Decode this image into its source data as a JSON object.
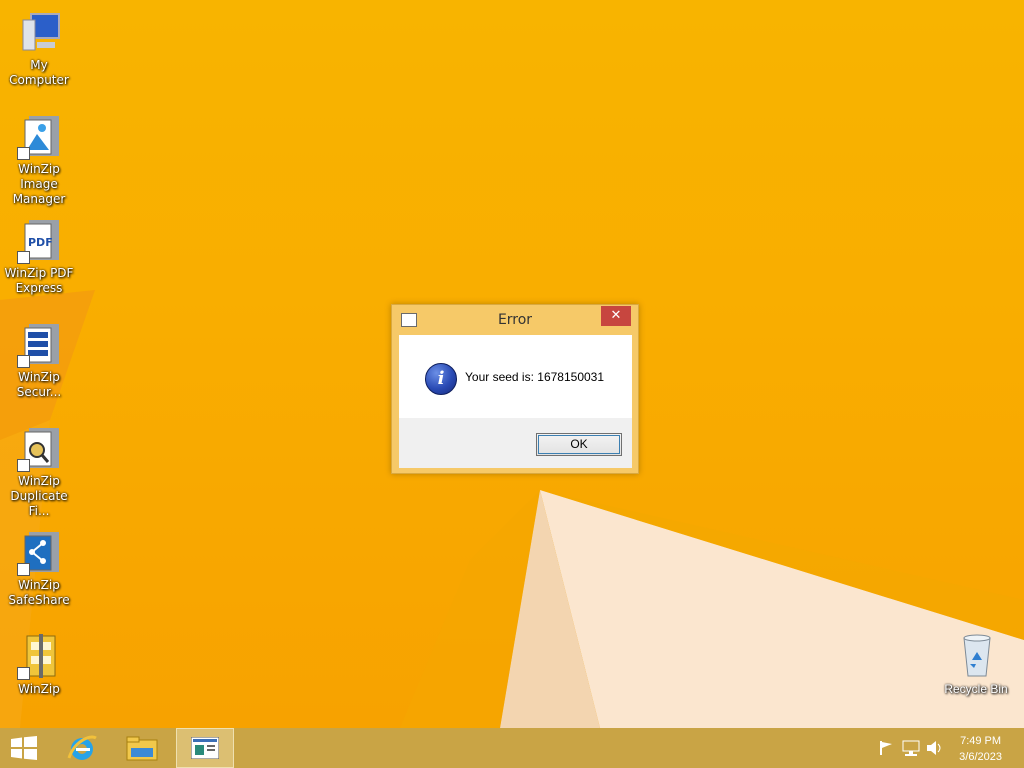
{
  "colors": {
    "desktop_bg": "#f8b400",
    "taskbar_bg": "#c9a445",
    "dialog_frame": "#f6c968",
    "close_button": "#c7463f",
    "info_blue": "#2a4bb5"
  },
  "desktop": {
    "icons": [
      {
        "label": "My Computer",
        "icon": "computer-icon"
      },
      {
        "label": "WinZip Image Manager",
        "icon": "winzip-image-manager-icon"
      },
      {
        "label": "WinZip PDF Express",
        "icon": "winzip-pdf-icon"
      },
      {
        "label": "WinZip Secur...",
        "icon": "winzip-secure-icon"
      },
      {
        "label": "WinZip Duplicate Fi...",
        "icon": "winzip-duplicate-icon"
      },
      {
        "label": "WinZip SafeShare",
        "icon": "winzip-safeshare-icon"
      },
      {
        "label": "WinZip",
        "icon": "winzip-icon"
      }
    ],
    "pdf_badge": "PDF",
    "recycle_bin": {
      "label": "Recycle Bin",
      "icon": "recycle-bin-icon"
    }
  },
  "dialog": {
    "title": "Error",
    "close_glyph": "✕",
    "info_glyph": "i",
    "message": "Your seed is: 1678150031",
    "ok_label": "OK"
  },
  "taskbar": {
    "start_icon": "windows-logo-icon",
    "pinned": [
      "internet-explorer-icon",
      "file-explorer-icon",
      "active-app-icon"
    ],
    "tray_icons": [
      "flag-icon",
      "network-icon",
      "volume-icon"
    ],
    "time": "7:49 PM",
    "date": "3/6/2023"
  }
}
